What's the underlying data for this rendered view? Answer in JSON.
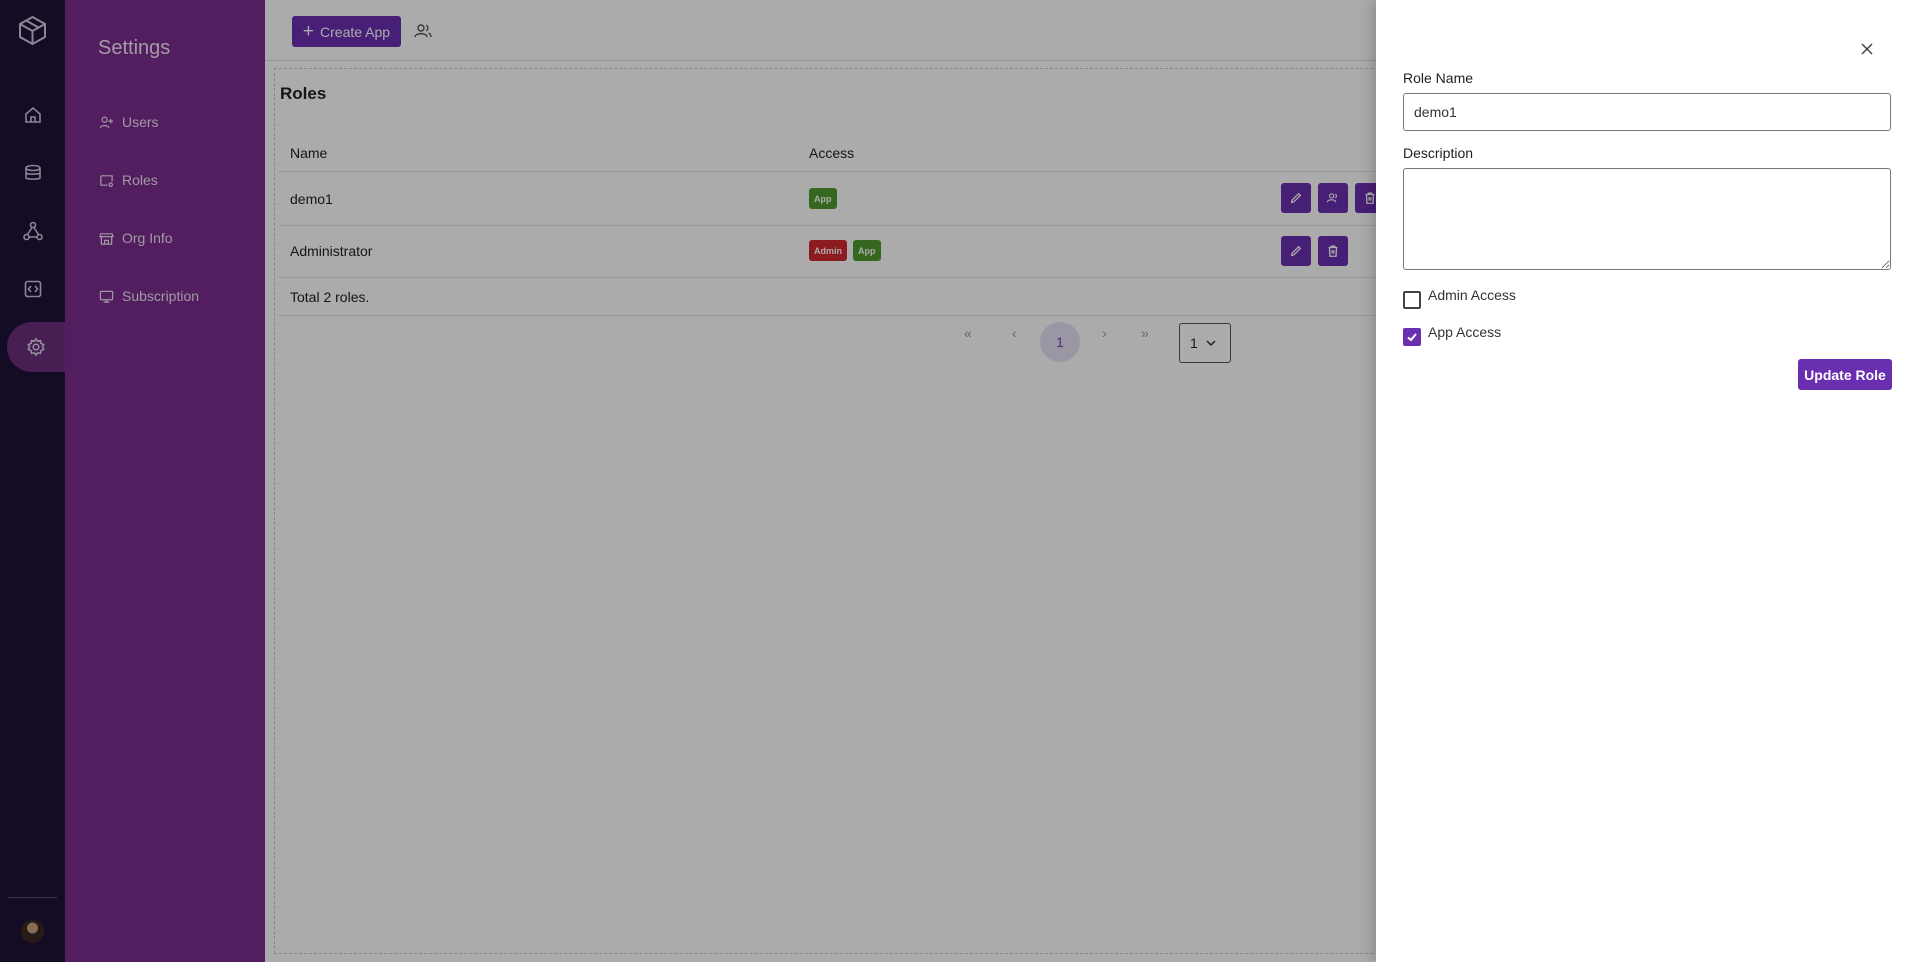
{
  "rail": {
    "items": [
      "logo-icon",
      "home-icon",
      "database-icon",
      "workflow-icon",
      "code-icon",
      "settings-icon"
    ],
    "active": "settings-icon"
  },
  "sidebar": {
    "title": "Settings",
    "items": [
      {
        "label": "Users",
        "icon": "user-add-icon"
      },
      {
        "label": "Roles",
        "icon": "roles-icon"
      },
      {
        "label": "Org Info",
        "icon": "store-icon"
      },
      {
        "label": "Subscription",
        "icon": "monitor-icon"
      }
    ]
  },
  "topbar": {
    "create_label": "Create App",
    "users_icon": "users-icon"
  },
  "roles": {
    "title": "Roles",
    "columns": [
      "Name",
      "Access"
    ],
    "rows": [
      {
        "name": "demo1",
        "badges": [
          "App"
        ],
        "actions": [
          "edit-icon",
          "users-icon",
          "delete-icon"
        ]
      },
      {
        "name": "Administrator",
        "badges": [
          "Admin",
          "App"
        ],
        "actions": [
          "edit-icon",
          "delete-icon"
        ]
      }
    ],
    "total": "Total 2 roles."
  },
  "pagination": {
    "first": "«",
    "prev": "‹",
    "current": "1",
    "next": "›",
    "last": "»",
    "page_size": "1"
  },
  "drawer": {
    "role_name_label": "Role Name",
    "role_name_value": "demo1",
    "description_label": "Description",
    "description_value": "",
    "admin_access_label": "Admin Access",
    "admin_access_checked": false,
    "app_access_label": "App Access",
    "app_access_checked": true,
    "update_label": "Update Role"
  },
  "colors": {
    "rail_bg": "#1f1237",
    "sidebar_bg": "#7b2d8e",
    "accent": "#6a2fb0",
    "badge_app": "#4f9a2e",
    "badge_admin": "#d1282f"
  }
}
